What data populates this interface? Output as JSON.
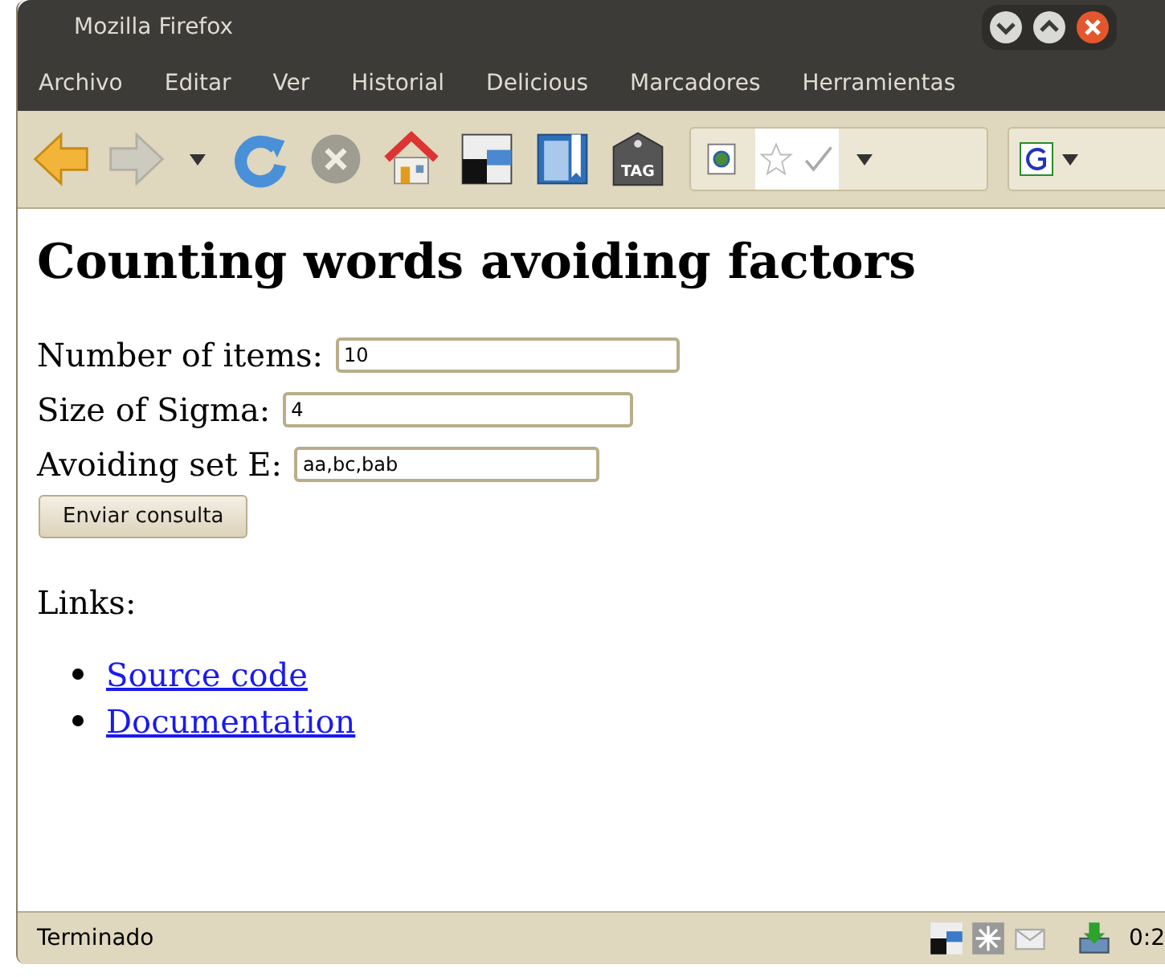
{
  "window": {
    "title": "Mozilla Firefox"
  },
  "menu": [
    {
      "label": "Archivo"
    },
    {
      "label": "Editar"
    },
    {
      "label": "Ver"
    },
    {
      "label": "Historial"
    },
    {
      "label": "Delicious"
    },
    {
      "label": "Marcadores"
    },
    {
      "label": "Herramientas"
    }
  ],
  "toolbar": {
    "back_disabled": false,
    "forward_disabled": true,
    "stop_disabled": true,
    "tag_label": "TAG"
  },
  "page": {
    "heading": "Counting words avoiding factors",
    "fields": [
      {
        "label": "Number of items:",
        "value": "10"
      },
      {
        "label": "Size of Sigma:",
        "value": "4"
      },
      {
        "label": "Avoiding set E:",
        "value": "aa,bc,bab"
      }
    ],
    "submit": "Enviar consulta",
    "links_label": "Links:",
    "links": [
      "Source code",
      "Documentation"
    ]
  },
  "status_bar": {
    "text": "Terminado",
    "clock": "0:2"
  }
}
